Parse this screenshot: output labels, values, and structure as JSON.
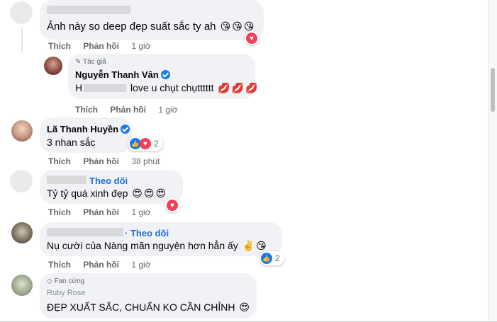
{
  "comments": [
    {
      "text": "Ảnh này so deep đẹp suất sắc ty ah",
      "emojis": [
        "😘",
        "😘",
        "😘"
      ],
      "actions": {
        "like": "Thích",
        "reply": "Phản hồi",
        "time": "1 giờ"
      }
    },
    {
      "author_badge": "Tác giả",
      "name": "Nguyễn Thanh Vân",
      "text_prefix": "H",
      "text": "love u chụt chụtttttt",
      "emojis": [
        "💋",
        "💋",
        "💋"
      ],
      "actions": {
        "like": "Thích",
        "reply": "Phản hồi",
        "time": "1 giờ"
      }
    },
    {
      "name": "Lã Thanh Huyền",
      "text": "3 nhan sắc",
      "reaction_count": "2",
      "actions": {
        "like": "Thích",
        "reply": "Phản hồi",
        "time": "38 phút"
      }
    },
    {
      "follow": "Theo dõi",
      "text": "Tỷ tỷ quá xinh đẹp",
      "emojis": [
        "😍",
        "😍",
        "😍"
      ],
      "actions": {
        "like": "Thích",
        "reply": "Phản hồi",
        "time": "1 giờ"
      }
    },
    {
      "follow": "· Theo dõi",
      "text": "Nụ cười của Nàng mãn nguyện hơn hẳn ấy",
      "emojis": [
        "✌️",
        "😘"
      ],
      "reaction_count": "2",
      "actions": {
        "like": "Thích",
        "reply": "Phản hồi",
        "time": "1 giờ"
      }
    },
    {
      "fan_badge": "Fan cứng",
      "name": "Ruby Rose",
      "text": "ĐẸP XUẤT SẮC, CHUẨN KO CẦN CHỈNH",
      "emojis": [
        "😍"
      ]
    }
  ]
}
